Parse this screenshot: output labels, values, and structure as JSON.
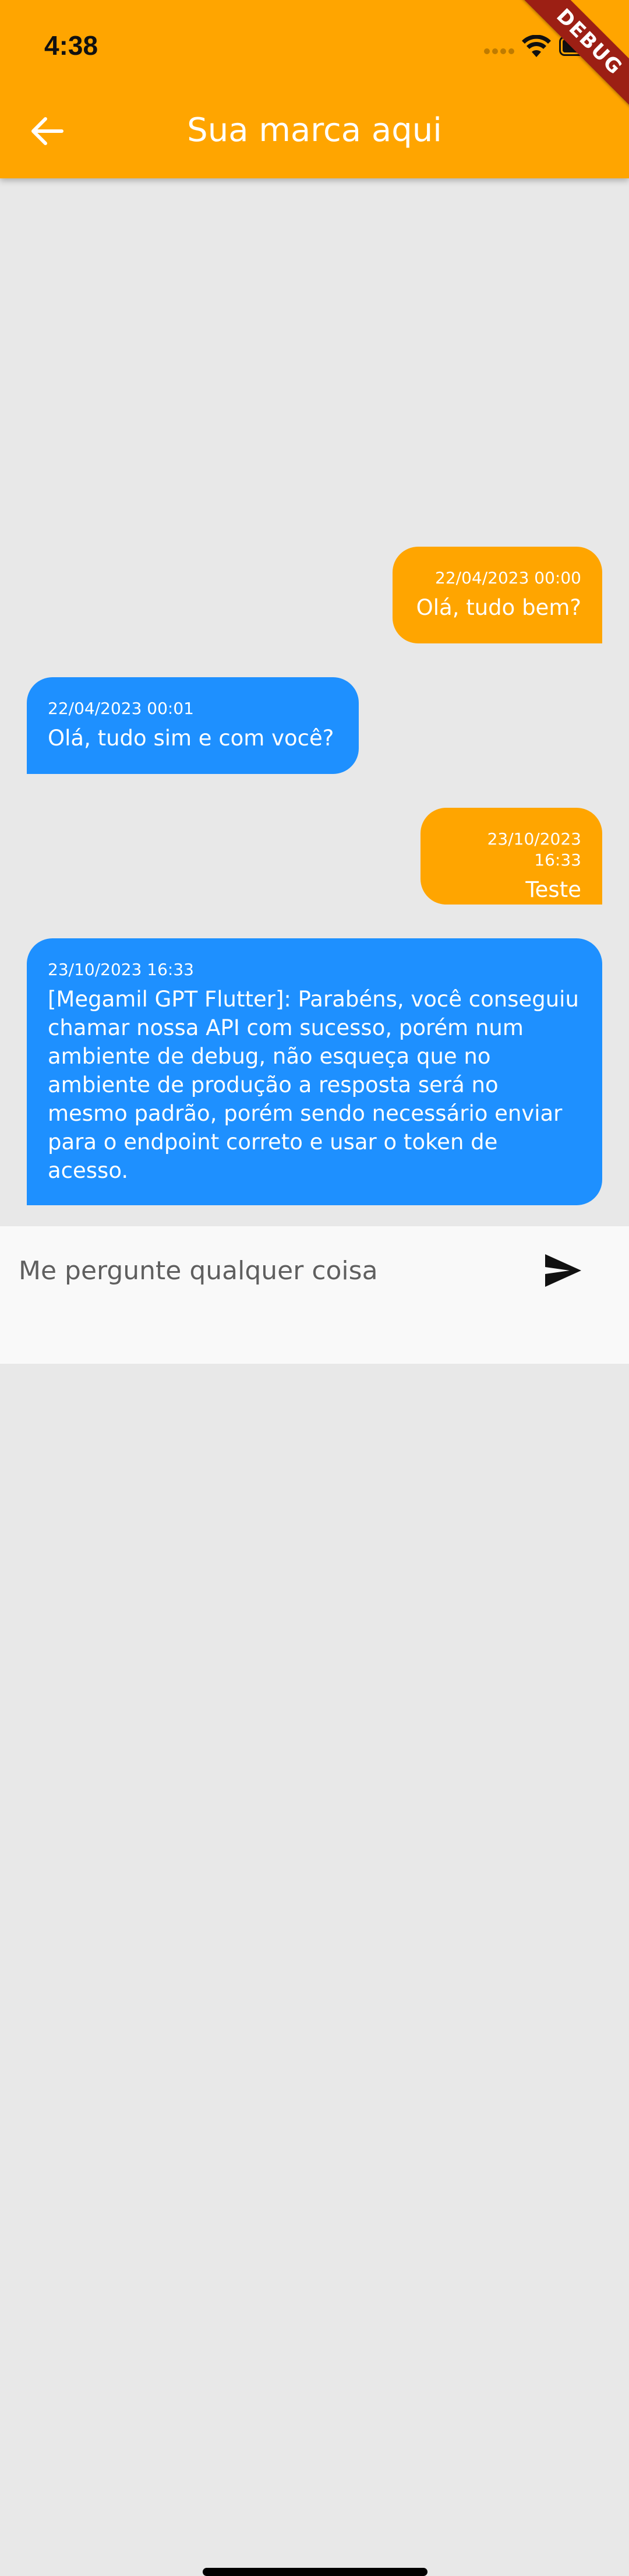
{
  "status_bar": {
    "time": "4:38"
  },
  "debug_banner": {
    "label": "DEBUG"
  },
  "header": {
    "title": "Sua marca aqui",
    "back_icon": "arrow-back-icon",
    "background_color": "#ffa500"
  },
  "chat": {
    "background_color": "#e8e8e8",
    "sent_color": "#ffa500",
    "received_color": "#1e90ff",
    "messages": [
      {
        "sender": "user",
        "timestamp": "22/04/2023 00:00",
        "text": "Olá, tudo bem?"
      },
      {
        "sender": "bot",
        "timestamp": "22/04/2023 00:01",
        "text": "Olá, tudo sim e com você?"
      },
      {
        "sender": "user",
        "timestamp": "23/10/2023 16:33",
        "text": "Teste"
      },
      {
        "sender": "bot",
        "timestamp": "23/10/2023 16:33",
        "text": "[Megamil GPT Flutter]: Parabéns, você conseguiu chamar nossa API com sucesso, porém num ambiente de debug, não esqueça que no ambiente de produção a resposta será no mesmo padrão, porém sendo necessário enviar para o endpoint correto e usar o token de acesso."
      }
    ]
  },
  "composer": {
    "placeholder": "Me pergunte qualquer coisa",
    "value": "",
    "send_icon": "send-icon"
  }
}
